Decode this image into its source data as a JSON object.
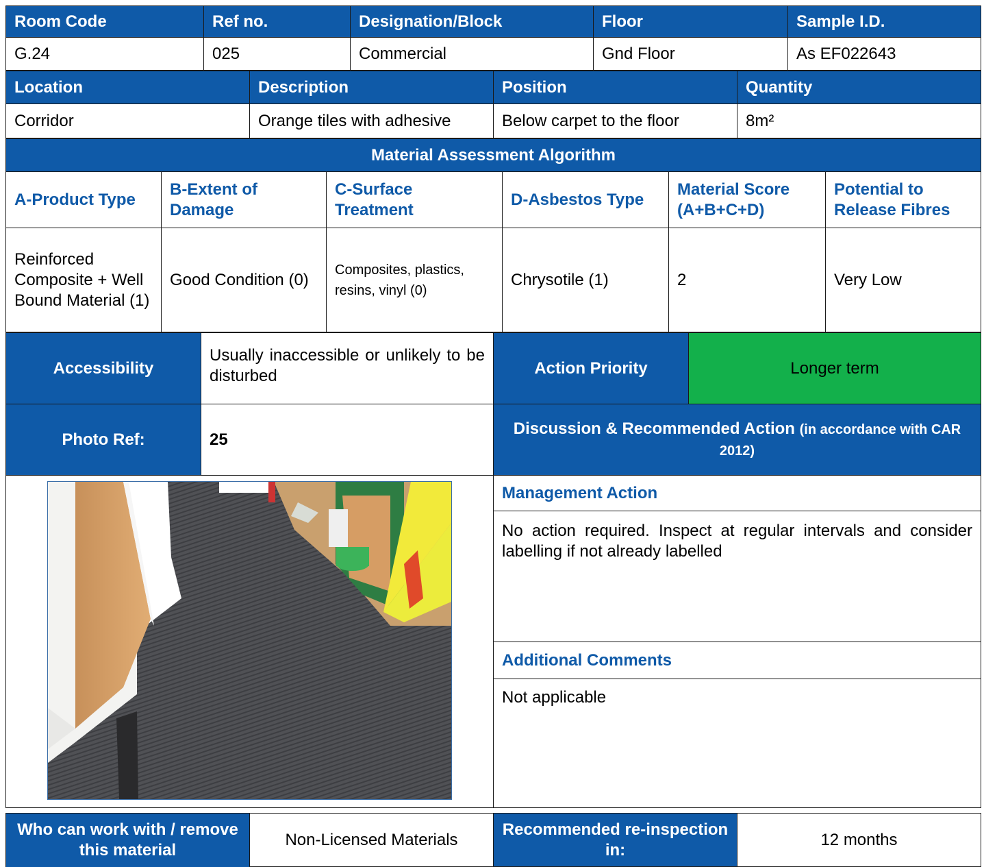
{
  "row1": {
    "headers": [
      "Room Code",
      "Ref no.",
      "Designation/Block",
      "Floor",
      "Sample I.D."
    ],
    "values": [
      "G.24",
      "025",
      "Commercial",
      "Gnd Floor",
      "As EF022643"
    ]
  },
  "row2": {
    "headers": [
      "Location",
      "Description",
      "Position",
      "Quantity"
    ],
    "values": [
      "Corridor",
      "Orange tiles with adhesive",
      "Below carpet to the floor",
      "8m²"
    ]
  },
  "algorithm": {
    "title": "Material Assessment Algorithm",
    "headers": [
      "A-Product Type",
      "B-Extent of Damage",
      "C-Surface Treatment",
      "D-Asbestos Type",
      "Material Score (A+B+C+D)",
      "Potential to Release Fibres"
    ],
    "values": [
      "Reinforced Composite + Well Bound Material (1)",
      "Good Condition (0)",
      "Composites, plastics, resins, vinyl (0)",
      "Chrysotile (1)",
      "2",
      "Very Low"
    ]
  },
  "accessibility": {
    "label": "Accessibility",
    "value": "Usually inaccessible or unlikely to be disturbed",
    "priority_label": "Action Priority",
    "priority_value": "Longer term",
    "priority_color": "#13b04b"
  },
  "photo": {
    "label": "Photo Ref:",
    "value": "25"
  },
  "discussion": {
    "title_main": "Discussion & Recommended Action",
    "title_note": "(in accordance with CAR 2012)",
    "management_label": "Management Action",
    "management_text": "No action required. Inspect at regular intervals and consider labelling if not already labelled",
    "comments_label": "Additional Comments",
    "comments_text": "Not applicable"
  },
  "footer": {
    "who_label": "Who can work with / remove this material",
    "who_value": "Non-Licensed Materials",
    "reinspect_label": "Recommended re-inspection in:",
    "reinspect_value": "12 months"
  },
  "colors": {
    "header_blue": "#0f5aa8",
    "priority_green": "#13b04b"
  }
}
